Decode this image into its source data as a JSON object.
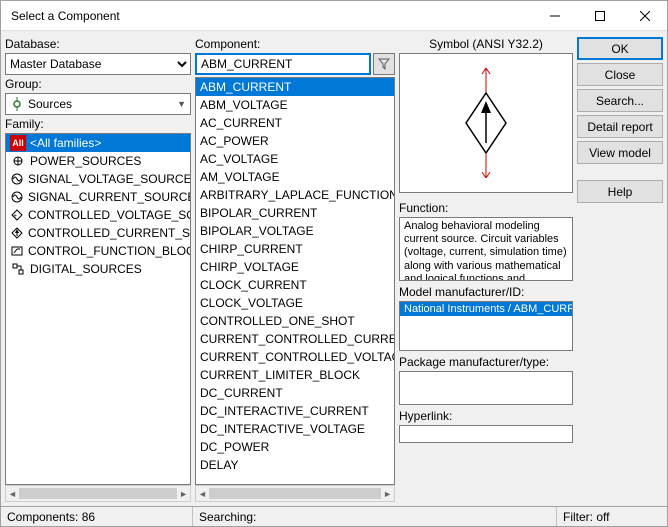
{
  "window_title": "Select a Component",
  "labels": {
    "database": "Database:",
    "group": "Group:",
    "family": "Family:",
    "component": "Component:",
    "symbol": "Symbol (ANSI Y32.2)",
    "function": "Function:",
    "model_mfr": "Model manufacturer/ID:",
    "package_mfr": "Package manufacturer/type:",
    "hyperlink": "Hyperlink:"
  },
  "database": {
    "selected": "Master Database"
  },
  "group": {
    "selected": "Sources",
    "icon": "sources-icon"
  },
  "families": [
    {
      "icon": "all-icon",
      "label": "<All families>",
      "selected": true
    },
    {
      "icon": "power-icon",
      "label": "POWER_SOURCES"
    },
    {
      "icon": "svs-icon",
      "label": "SIGNAL_VOLTAGE_SOURCES"
    },
    {
      "icon": "scs-icon",
      "label": "SIGNAL_CURRENT_SOURCES"
    },
    {
      "icon": "cvs-icon",
      "label": "CONTROLLED_VOLTAGE_SOURCES"
    },
    {
      "icon": "ccs-icon",
      "label": "CONTROLLED_CURRENT_SOURCES"
    },
    {
      "icon": "cfb-icon",
      "label": "CONTROL_FUNCTION_BLOCKS"
    },
    {
      "icon": "dig-icon",
      "label": "DIGITAL_SOURCES"
    }
  ],
  "component_input": "ABM_CURRENT",
  "components": [
    "ABM_CURRENT",
    "ABM_VOLTAGE",
    "AC_CURRENT",
    "AC_POWER",
    "AC_VOLTAGE",
    "AM_VOLTAGE",
    "ARBITRARY_LAPLACE_FUNCTION",
    "BIPOLAR_CURRENT",
    "BIPOLAR_VOLTAGE",
    "CHIRP_CURRENT",
    "CHIRP_VOLTAGE",
    "CLOCK_CURRENT",
    "CLOCK_VOLTAGE",
    "CONTROLLED_ONE_SHOT",
    "CURRENT_CONTROLLED_CURRENT_SOURCE",
    "CURRENT_CONTROLLED_VOLTAGE_SOURCE",
    "CURRENT_LIMITER_BLOCK",
    "DC_CURRENT",
    "DC_INTERACTIVE_CURRENT",
    "DC_INTERACTIVE_VOLTAGE",
    "DC_POWER",
    "DELAY"
  ],
  "component_selected_index": 0,
  "function_text": "Analog behavioral modeling current source. Circuit variables (voltage, current, simulation time) along with various mathematical and logical functions and operators can be used to control this source's output.",
  "model_mfr_items": [
    "National Instruments / ABM_CURRENT"
  ],
  "buttons": {
    "ok": "OK",
    "close": "Close",
    "search": "Search...",
    "detail": "Detail report",
    "viewmodel": "View model",
    "help": "Help"
  },
  "status": {
    "components": "Components: 86",
    "searching": "Searching:",
    "filter": "Filter: off"
  }
}
